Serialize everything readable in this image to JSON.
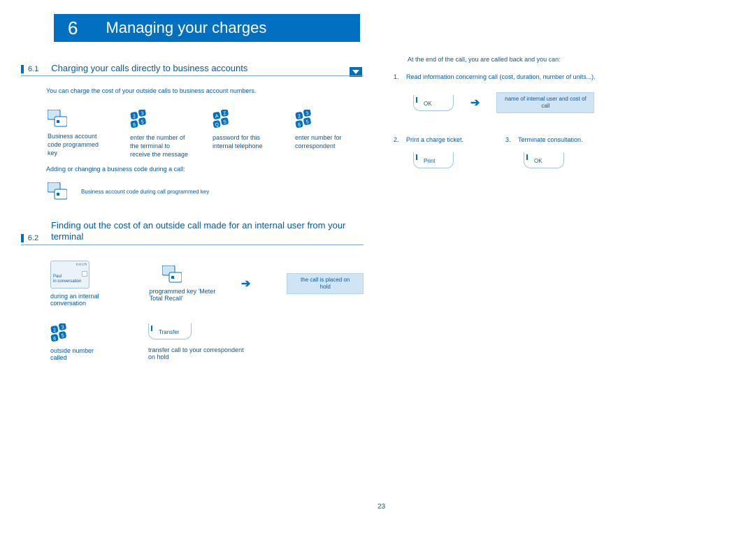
{
  "chapter": {
    "number": "6",
    "title": "Managing your charges"
  },
  "section61": {
    "num": "6.1",
    "title": "Charging your calls directly to business accounts",
    "intro": "You can charge the cost of your outside calls to business account numbers.",
    "items": [
      "Business account code programmed key",
      "enter the number of the terminal to receive the message",
      "password for this internal telephone",
      "enter number for correspondent"
    ],
    "note": "Adding or changing a business code during a call:",
    "note2": "Business account code during call programmed key"
  },
  "section62": {
    "num": "6.2",
    "title": "Finding out the cost of an outside call made for an internal user from your terminal",
    "screen_top": "n o c h",
    "screen_l1": "Paul",
    "screen_l2": "in conversation",
    "items_row1": [
      "during an internal conversation",
      "programmed key 'Meter Total Recall'",
      "the call is placed on hold"
    ],
    "transfer_label": "Transfer",
    "items_row2": [
      "outside number called",
      "transfer call to your correspondent on hold"
    ]
  },
  "rightcol": {
    "intro": "At the end of the call, you are called back and you can:",
    "li1_num": "1.",
    "li1": "Read information concerning call (cost, duration, number of units...).",
    "ok_label": "OK",
    "box1": "name of internal user and cost of call",
    "li2_num": "2.",
    "li2": "Print a charge ticket.",
    "li3_num": "3.",
    "li3": "Terminate consultation.",
    "print_label": "Print"
  },
  "page": "23"
}
